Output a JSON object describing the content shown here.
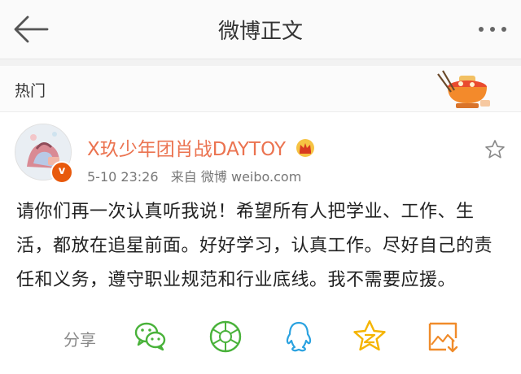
{
  "header": {
    "title": "微博正文",
    "back_icon": "back-arrow-icon",
    "more_icon": "more-dots-icon"
  },
  "hot": {
    "label": "热门"
  },
  "post": {
    "username": "X玖少年团肖战DAYTOY",
    "verified_mark": "v",
    "date": "5-10 23:26",
    "source_prefix": "来自",
    "source": "微博 weibo.com",
    "text": "请你们再一次认真听我说！希望所有人把学业、工作、生活，都放在追星前面。好好学习，认真工作。尽好自己的责任和义务，遵守职业规范和行业底线。我不需要应援。"
  },
  "share": {
    "label": "分享",
    "icons": [
      "wechat-icon",
      "moments-icon",
      "qq-icon",
      "qzone-icon",
      "save-image-icon"
    ]
  },
  "colors": {
    "accent_username": "#eb7350",
    "share_green": "#49b23a",
    "qq_blue": "#2aa2e0",
    "qzone_yellow": "#f5b400",
    "save_orange": "#f08b2a"
  }
}
